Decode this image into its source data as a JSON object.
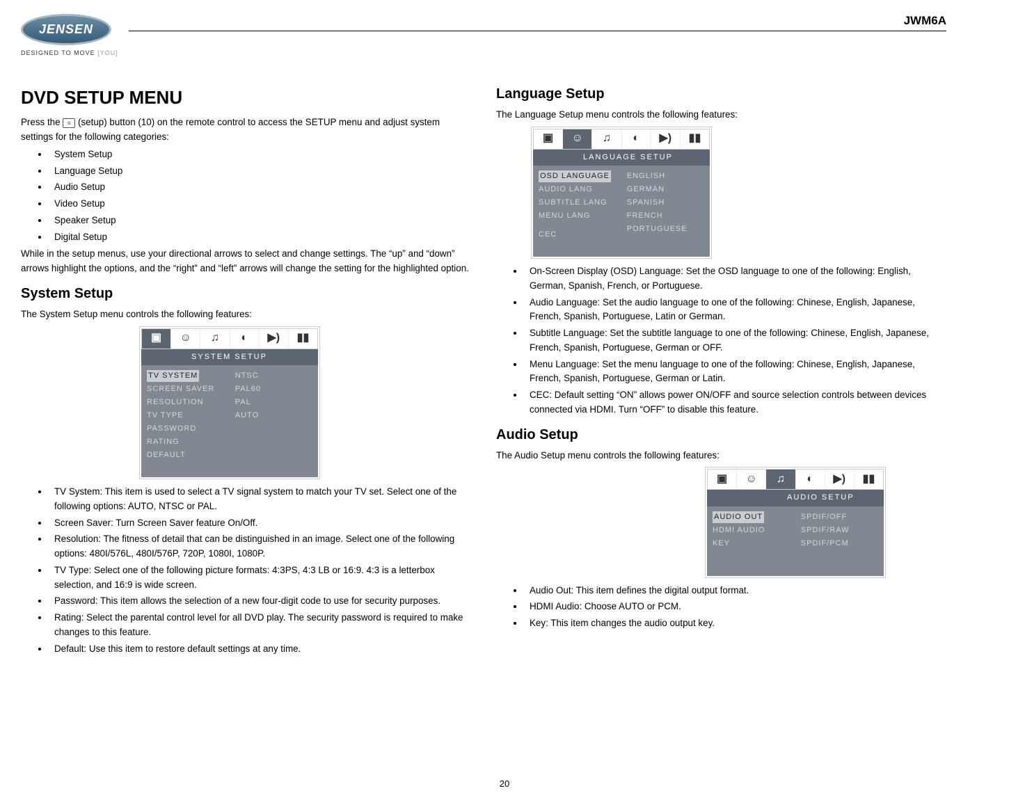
{
  "header": {
    "brand": "JENSEN",
    "tagline_a": "DESIGNED TO MOVE ",
    "tagline_b": "[YOU]",
    "model": "JWM6A",
    "page_number": "20"
  },
  "left": {
    "h1": "DVD SETUP MENU",
    "intro_a": "Press the ",
    "intro_b": " (setup) button (10) on the remote control to access the SETUP menu and adjust system settings for the following categories:",
    "cats": {
      "a": "System Setup",
      "b": "Language Setup",
      "c": "Audio Setup",
      "d": "Video Setup",
      "e": "Speaker Setup",
      "f": "Digital Setup"
    },
    "nav_note": "While in the setup menus, use your directional arrows to select and change settings. The “up” and “down” arrows highlight the options, and the “right” and “left” arrows will change the setting for the highlighted option.",
    "sys_h": "System Setup",
    "sys_intro": "The System Setup menu controls the following features:",
    "sys_menu": {
      "title": "SYSTEM  SETUP",
      "l0": "TV SYSTEM",
      "l1": "SCREEN SAVER",
      "l2": "RESOLUTION",
      "l3": "TV TYPE",
      "l4": "PASSWORD",
      "l5": "RATING",
      "l6": "DEFAULT",
      "r0": "NTSC",
      "r1": "PAL60",
      "r2": "PAL",
      "r3": "AUTO"
    },
    "sys_items": {
      "a": "TV System: This item is used to select a TV signal system to match your TV set. Select one of the following options: AUTO, NTSC or PAL.",
      "b": "Screen Saver: Turn Screen Saver feature On/Off.",
      "c": "Resolution: The fitness of detail that can be distinguished in an image. Select one of the following options: 480I/576L, 480I/576P, 720P, 1080I, 1080P.",
      "d": "TV Type: Select one of the following picture formats: 4:3PS, 4:3 LB or 16:9. 4:3 is a letterbox selection, and 16:9 is wide screen.",
      "e": "Password: This item allows the selection of a new four-digit code to use for security purposes.",
      "f": "Rating: Select the parental control level for all DVD play. The security password is required to make changes to this feature.",
      "g": "Default: Use this item to restore default settings at any time."
    }
  },
  "right": {
    "lang_h": "Language Setup",
    "lang_intro": "The Language Setup menu controls the following features:",
    "lang_menu": {
      "title": "LANGUAGE  SETUP",
      "l0": "OSD LANGUAGE",
      "l1": "AUDIO LANG",
      "l2": "SUBTITLE  LANG",
      "l3": "MENU LANG",
      "l4": "CEC",
      "r0": "ENGLISH",
      "r1": "GERMAN",
      "r2": "SPANISH",
      "r3": "FRENCH",
      "r4": "PORTUGUESE"
    },
    "lang_items": {
      "a": "On-Screen Display (OSD) Language: Set the OSD language to one of the following: English, German, Spanish, French, or Portuguese.",
      "b": "Audio Language: Set the audio language to one of the following: Chinese, English, Japanese, French, Spanish, Portuguese, Latin or German.",
      "c": "Subtitle Language: Set the subtitle language to one of the following: Chinese, English, Japanese, French, Spanish, Portuguese, German or OFF.",
      "d": "Menu Language: Set the menu language to one of the following: Chinese, English, Japanese, French, Spanish, Portuguese, German or Latin.",
      "e": "CEC: Default setting “ON” allows power ON/OFF and source selection controls between devices connected via HDMI. Turn “OFF” to disable this feature."
    },
    "aud_h": "Audio Setup",
    "aud_intro": "The Audio Setup menu controls the following features:",
    "aud_menu": {
      "title": "AUDIO  SETUP",
      "l0": "AUDIO  OUT",
      "l1": "HDMI  AUDIO",
      "l2": "KEY",
      "r0": "SPDIF/OFF",
      "r1": "SPDIF/RAW",
      "r2": "SPDIF/PCM"
    },
    "aud_items": {
      "a": "Audio Out: This item defines the digital output format.",
      "b": "HDMI Audio: Choose AUTO or PCM.",
      "c": "Key: This item changes the audio output key."
    }
  },
  "icons": {
    "monitor": "▣",
    "person": "☺",
    "note": "♫",
    "disc": "◐",
    "speaker": "▶)",
    "dolby": "▮▮"
  }
}
